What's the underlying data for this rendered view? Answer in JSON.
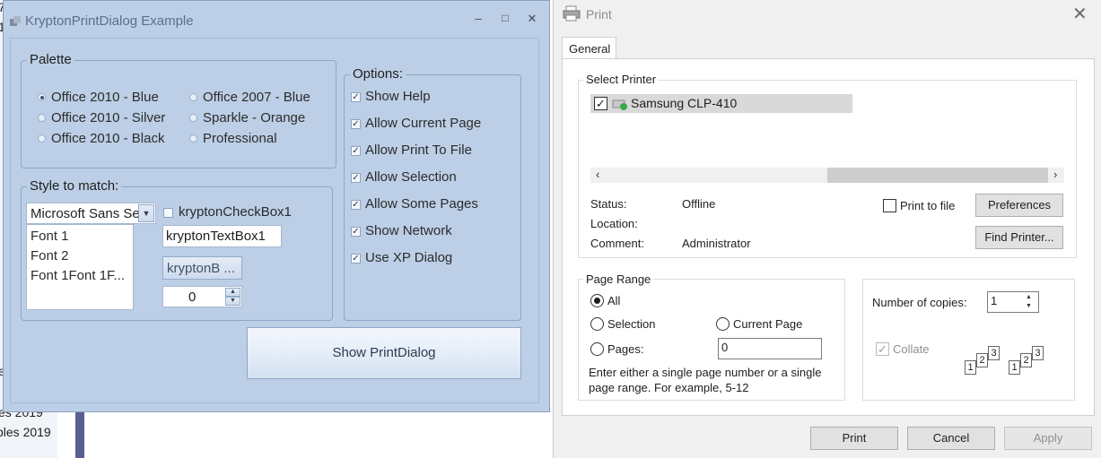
{
  "background": {
    "items": [
      "7",
      "1",
      "e",
      "es 2019",
      "bles 2019"
    ],
    "partial_header": [
      "Office 2010 - Black",
      "Professional"
    ]
  },
  "krypton": {
    "title": "KryptonPrintDialog Example",
    "window_controls": [
      "–",
      "□",
      "✕"
    ],
    "palette": {
      "label": "Palette",
      "options": [
        "Office 2010 - Blue",
        "Office 2010 - Silver",
        "Office 2010 - Black",
        "Office 2007 - Blue",
        "Sparkle - Orange",
        "Professional"
      ],
      "selected": "Office 2010 - Blue"
    },
    "style": {
      "label": "Style to match:",
      "combo_value": "Microsoft Sans Se",
      "list_items": [
        "Font 1",
        "Font 2",
        "Font  1Font  1F..."
      ],
      "checkbox_label": "kryptonCheckBox1",
      "textbox_value": "kryptonTextBox1",
      "button_label": "kryptonB ...",
      "numeric_value": "0"
    },
    "options": {
      "label": "Options:",
      "items": [
        "Show Help",
        "Allow Current Page",
        "Allow Print To File",
        "Allow Selection",
        "Allow Some Pages",
        "Show Network",
        "Use XP Dialog"
      ]
    },
    "show_button": "Show PrintDialog"
  },
  "print": {
    "title": "Print",
    "tab": "General",
    "select_printer_label": "Select Printer",
    "printer_name": "Samsung CLP-410",
    "status_label": "Status:",
    "status_value": "Offline",
    "location_label": "Location:",
    "location_value": "",
    "comment_label": "Comment:",
    "comment_value": "Administrator",
    "print_to_file_label": "Print to file",
    "preferences_label": "Preferences",
    "find_printer_label": "Find Printer...",
    "page_range": {
      "label": "Page Range",
      "all_label": "All",
      "selection_label": "Selection",
      "current_page_label": "Current Page",
      "pages_label": "Pages:",
      "pages_value": "0",
      "hint_line1": "Enter either a single page number or a single",
      "hint_line2": "page range.  For example, 5-12",
      "selected": "All"
    },
    "copies": {
      "label": "Number of copies:",
      "value": "1",
      "collate_label": "Collate",
      "collate_checked": true
    },
    "buttons": {
      "print": "Print",
      "cancel": "Cancel",
      "apply": "Apply"
    }
  }
}
